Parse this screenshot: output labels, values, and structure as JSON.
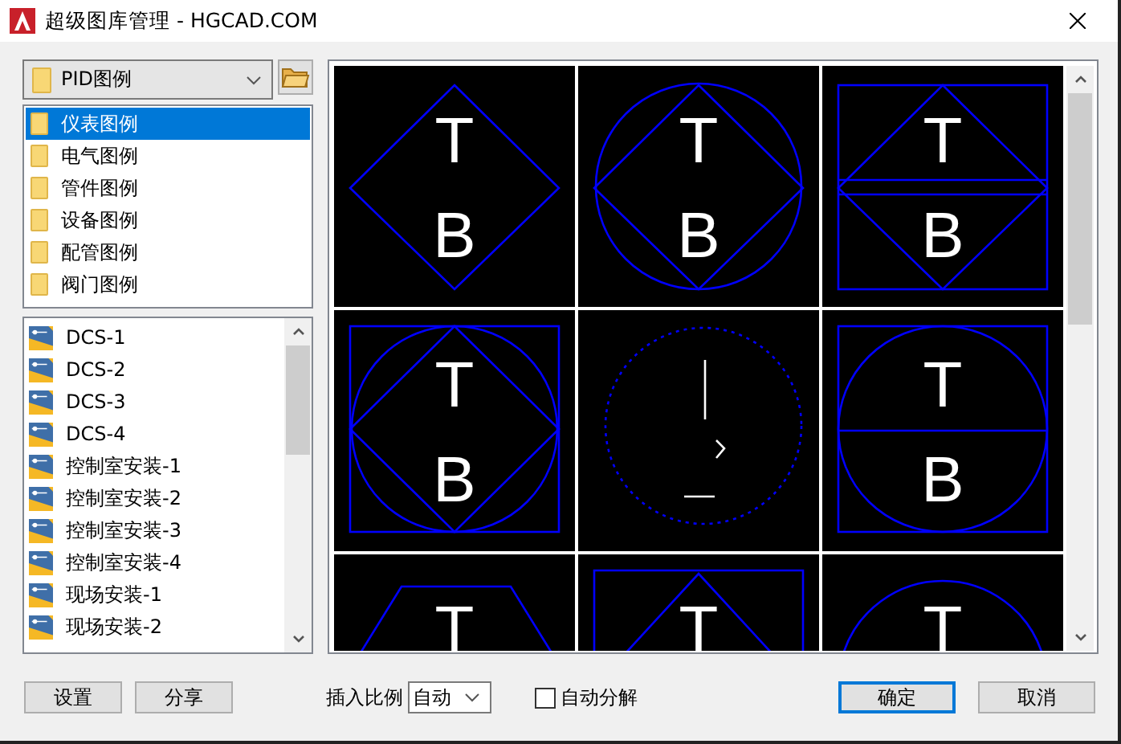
{
  "window": {
    "title": "超级图库管理 - HGCAD.COM"
  },
  "category_select": {
    "value": "PID图例"
  },
  "folders": [
    {
      "label": "仪表图例",
      "selected": true
    },
    {
      "label": "电气图例",
      "selected": false
    },
    {
      "label": "管件图例",
      "selected": false
    },
    {
      "label": "设备图例",
      "selected": false
    },
    {
      "label": "配管图例",
      "selected": false
    },
    {
      "label": "阀门图例",
      "selected": false
    }
  ],
  "files": [
    {
      "label": "DCS-1"
    },
    {
      "label": "DCS-2"
    },
    {
      "label": "DCS-3"
    },
    {
      "label": "DCS-4"
    },
    {
      "label": "控制室安装-1"
    },
    {
      "label": "控制室安装-2"
    },
    {
      "label": "控制室安装-3"
    },
    {
      "label": "控制室安装-4"
    },
    {
      "label": "现场安装-1"
    },
    {
      "label": "现场安装-2"
    }
  ],
  "thumbnails": [
    {
      "kind": "diamond",
      "top": "T",
      "bottom": "B"
    },
    {
      "kind": "circle-diamond",
      "top": "T",
      "bottom": "B"
    },
    {
      "kind": "rect-diamond-split",
      "top": "T",
      "bottom": "B"
    },
    {
      "kind": "rect-circle-diamond",
      "top": "T",
      "bottom": "B"
    },
    {
      "kind": "dashed-circle"
    },
    {
      "kind": "rect-circle-split",
      "top": "T",
      "bottom": "B"
    },
    {
      "kind": "trapezoid",
      "top": "T"
    },
    {
      "kind": "rect-triangle",
      "top": "T"
    },
    {
      "kind": "circle",
      "top": "T"
    }
  ],
  "footer": {
    "settings_button": "设置",
    "share_button": "分享",
    "scale_label": "插入比例",
    "scale_select": "自动",
    "explode": {
      "label": "自动分解",
      "checked": false
    },
    "ok_button": "确定",
    "cancel_button": "取消"
  }
}
